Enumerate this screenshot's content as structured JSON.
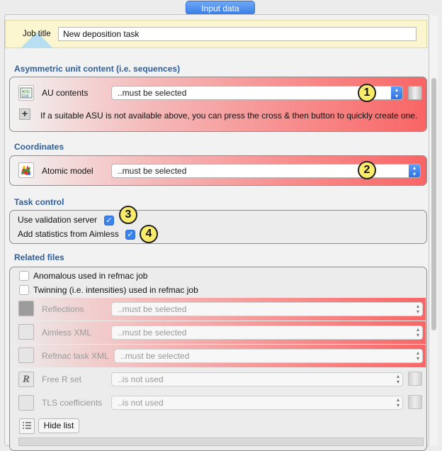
{
  "header": {
    "title": "Input data"
  },
  "job": {
    "label": "Job title",
    "value": "New deposition task"
  },
  "asu": {
    "section_title": "Asymmetric unit content (i.e. sequences)",
    "label": "AU contents",
    "select_value": "..must be selected",
    "hint": "If a suitable ASU is not available above, you can press the cross & then button to quickly create one.",
    "marker": "1"
  },
  "coords": {
    "section_title": "Coordinates",
    "label": "Atomic model",
    "select_value": "..must be selected",
    "marker": "2"
  },
  "task": {
    "section_title": "Task control",
    "validation_label": "Use validation server",
    "aimless_label": "Add statistics from Aimless",
    "validation_checked": true,
    "aimless_checked": true,
    "marker_validation": "3",
    "marker_aimless": "4"
  },
  "related": {
    "section_title": "Related files",
    "anomalous_label": "Anomalous used in refmac job",
    "twinning_label": "Twinning (i.e. intensities) used in refmac job",
    "rows": [
      {
        "label": "Reflections",
        "value": "..must be selected"
      },
      {
        "label": "Aimless XML",
        "value": "..must be selected"
      },
      {
        "label": "Refmac task XML",
        "value": "..must be selected"
      },
      {
        "label": "Free R set",
        "value": "..is not used"
      },
      {
        "label": "TLS coefficients",
        "value": "..is not used"
      }
    ],
    "hide_list_label": "Hide list"
  },
  "colors": {
    "accent": "#2c5f9e",
    "button": "#3a7ee8",
    "error": "#f96565",
    "marker": "#f8ec6a"
  }
}
